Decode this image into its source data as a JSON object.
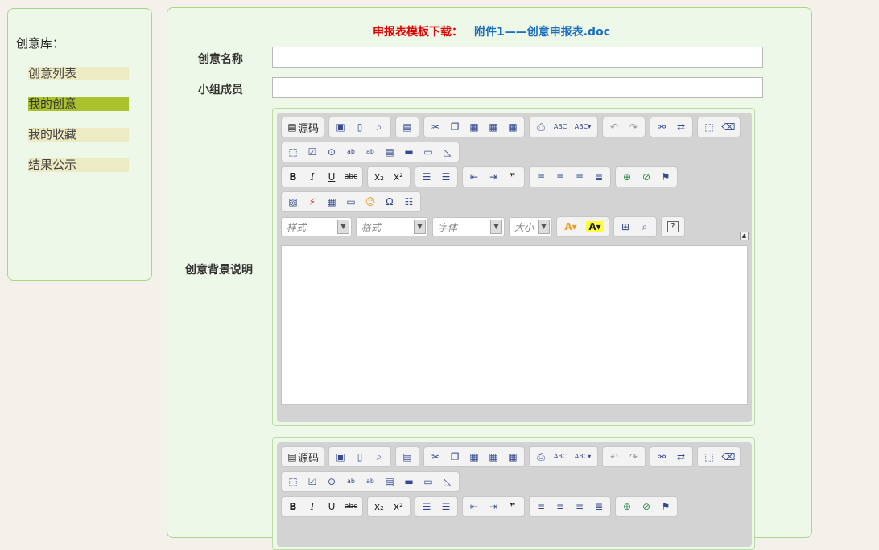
{
  "sidebar": {
    "title": "创意库：",
    "items": [
      {
        "label": "创意列表"
      },
      {
        "label": "我的创意"
      },
      {
        "label": "我的收藏"
      },
      {
        "label": "结果公示"
      }
    ]
  },
  "download": {
    "label": "申报表模板下载：",
    "link": "附件1——创意申报表.doc"
  },
  "form": {
    "name_label": "创意名称",
    "name_value": "",
    "members_label": "小组成员",
    "members_value": "",
    "background_label": "创意背景说明"
  },
  "editor": {
    "source_label": "源码",
    "style_placeholder": "样式",
    "format_placeholder": "格式",
    "font_placeholder": "字体",
    "size_placeholder": "大小",
    "accent_colors": {
      "red": "#e00000",
      "link": "#1c6fbf",
      "sidebar_active": "#a8c12c"
    }
  }
}
